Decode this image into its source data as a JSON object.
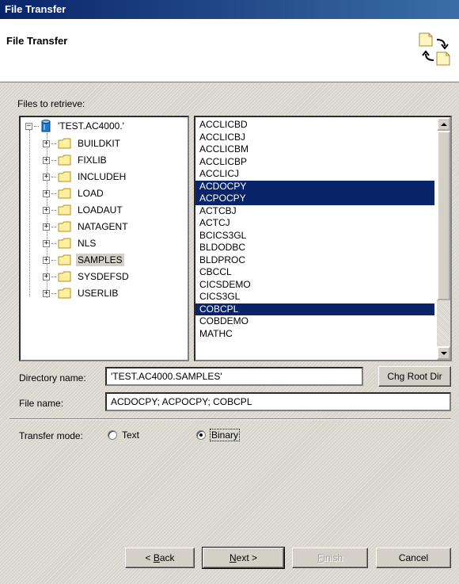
{
  "window": {
    "title": "File Transfer"
  },
  "header": {
    "title": "File Transfer",
    "icon": "file-transfer-icon"
  },
  "files_label": "Files to retrieve:",
  "tree": {
    "root": {
      "label": "'TEST.AC4000.'",
      "icon": "database-icon",
      "expanded": true
    },
    "children": [
      {
        "label": "BUILDKIT"
      },
      {
        "label": "FIXLIB"
      },
      {
        "label": "INCLUDEH"
      },
      {
        "label": "LOAD"
      },
      {
        "label": "LOADAUT"
      },
      {
        "label": "NATAGENT"
      },
      {
        "label": "NLS"
      },
      {
        "label": "SAMPLES",
        "selected": true
      },
      {
        "label": "SYSDEFSD"
      },
      {
        "label": "USERLIB"
      }
    ]
  },
  "file_list": {
    "items": [
      {
        "label": "ACCLICBD"
      },
      {
        "label": "ACCLICBJ"
      },
      {
        "label": "ACCLICBM"
      },
      {
        "label": "ACCLICBP"
      },
      {
        "label": "ACCLICJ"
      },
      {
        "label": "ACDOCPY",
        "selected": true
      },
      {
        "label": "ACPOCPY",
        "selected": true
      },
      {
        "label": "ACTCBJ"
      },
      {
        "label": "ACTCJ"
      },
      {
        "label": "BCICS3GL"
      },
      {
        "label": "BLDODBC"
      },
      {
        "label": "BLDPROC"
      },
      {
        "label": "CBCCL"
      },
      {
        "label": "CICSDEMO"
      },
      {
        "label": "CICS3GL"
      },
      {
        "label": "COBCPL",
        "selected": true
      },
      {
        "label": "COBDEMO"
      },
      {
        "label": "MATHC"
      }
    ]
  },
  "directory": {
    "label": "Directory name:",
    "value": "'TEST.AC4000.SAMPLES'",
    "button": "Chg Root Dir"
  },
  "file_name": {
    "label": "File name:",
    "value": "ACDOCPY; ACPOCPY; COBCPL"
  },
  "transfer_mode": {
    "label": "Transfer mode:",
    "options": [
      {
        "label": "Text",
        "selected": false
      },
      {
        "label": "Binary",
        "selected": true
      }
    ]
  },
  "buttons": {
    "back": {
      "prefix": "< ",
      "underline": "B",
      "rest": "ack"
    },
    "next": {
      "underline": "N",
      "rest": "ext >"
    },
    "finish": {
      "underline": "F",
      "rest": "inish"
    },
    "cancel": "Cancel"
  },
  "colors": {
    "selection": "#0a246a",
    "titlebar_start": "#0a246a",
    "titlebar_end": "#3a6ea5",
    "dialog": "#d4d0c8"
  }
}
